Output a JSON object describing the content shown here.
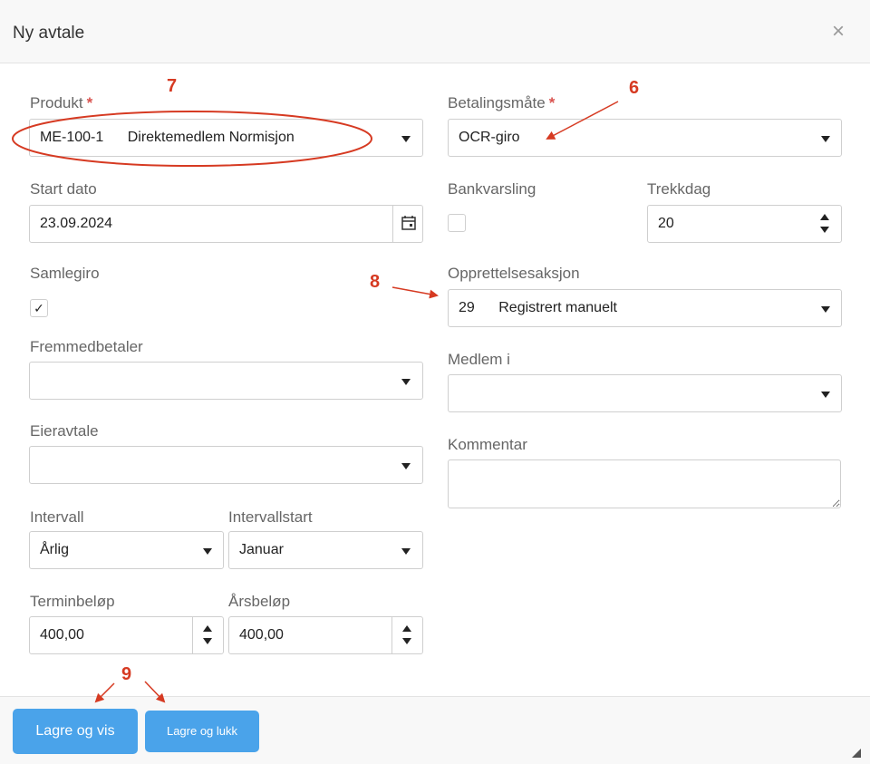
{
  "dialog": {
    "title": "Ny avtale",
    "close_icon": "close-icon"
  },
  "fields": {
    "produkt": {
      "label": "Produkt",
      "required_mark": "*",
      "code": "ME-100-1",
      "name": "Direktemedlem Normisjon"
    },
    "betalingsmate": {
      "label": "Betalingsmåte",
      "required_mark": "*",
      "value": "OCR-giro"
    },
    "startdato": {
      "label": "Start dato",
      "value": "23.09.2024"
    },
    "bankvarsling": {
      "label": "Bankvarsling",
      "checked": false
    },
    "trekkdag": {
      "label": "Trekkdag",
      "value": "20"
    },
    "samlegiro": {
      "label": "Samlegiro",
      "checked": true,
      "check_glyph": "✓"
    },
    "opprettelsesaksjon": {
      "label": "Opprettelsesaksjon",
      "code": "29",
      "name": "Registrert manuelt"
    },
    "fremmedbetaler": {
      "label": "Fremmedbetaler",
      "value": ""
    },
    "medlem_i": {
      "label": "Medlem i",
      "value": ""
    },
    "eieravtale": {
      "label": "Eieravtale",
      "value": ""
    },
    "kommentar": {
      "label": "Kommentar",
      "value": ""
    },
    "intervall": {
      "label": "Intervall",
      "value": "Årlig"
    },
    "intervallstart": {
      "label": "Intervallstart",
      "value": "Januar"
    },
    "terminbelop": {
      "label": "Terminbeløp",
      "value": "400,00"
    },
    "arsbelop": {
      "label": "Årsbeløp",
      "value": "400,00"
    }
  },
  "buttons": {
    "save_view": "Lagre og vis",
    "save_close": "Lagre og lukk"
  },
  "annotations": {
    "n6": "6",
    "n7": "7",
    "n8": "8",
    "n9": "9",
    "color": "#d63a22"
  },
  "colors": {
    "primary": "#4aa3ea",
    "required": "#d9534f"
  }
}
